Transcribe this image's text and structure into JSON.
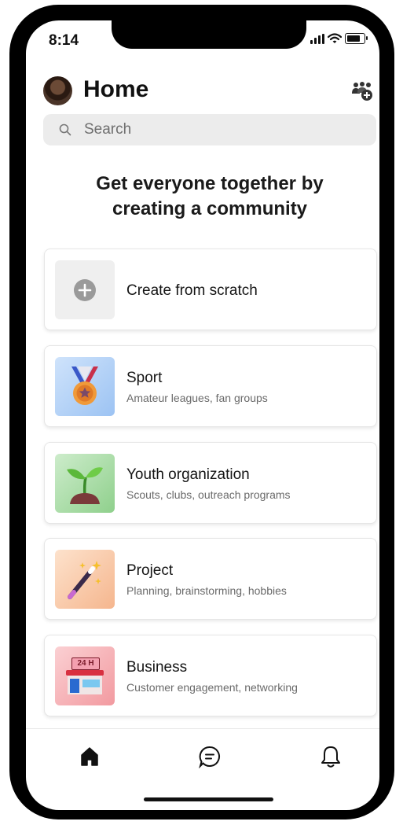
{
  "status": {
    "time": "8:14"
  },
  "header": {
    "title": "Home"
  },
  "search": {
    "placeholder": "Search"
  },
  "headline": {
    "line1": "Get everyone together by",
    "line2": "creating a community"
  },
  "cards": [
    {
      "title": "Create from scratch",
      "subtitle": "",
      "icon": "plus-circle-icon"
    },
    {
      "title": "Sport",
      "subtitle": "Amateur leagues, fan groups",
      "icon": "medal-icon"
    },
    {
      "title": "Youth organization",
      "subtitle": "Scouts, clubs, outreach programs",
      "icon": "sprout-icon"
    },
    {
      "title": "Project",
      "subtitle": "Planning, brainstorming, hobbies",
      "icon": "magic-wand-icon"
    },
    {
      "title": "Business",
      "subtitle": "Customer engagement, networking",
      "icon": "store-24h-icon"
    }
  ],
  "store_sign": "24 H",
  "tabbar": {
    "items": [
      "home-icon",
      "chat-icon",
      "bell-icon"
    ]
  }
}
